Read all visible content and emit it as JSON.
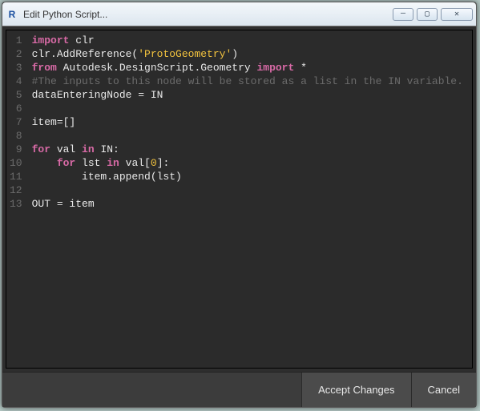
{
  "window": {
    "title": "Edit Python Script...",
    "app_icon_letter": "R"
  },
  "win_controls": {
    "minimize": "—",
    "maximize": "▢",
    "close": "✕"
  },
  "footer": {
    "accept": "Accept Changes",
    "cancel": "Cancel"
  },
  "code": {
    "line_numbers": [
      "1",
      "2",
      "3",
      "4",
      "5",
      "6",
      "7",
      "8",
      "9",
      "10",
      "11",
      "12",
      "13"
    ],
    "lines": [
      {
        "tokens": [
          {
            "t": "import",
            "c": "kw"
          },
          {
            "t": " clr",
            "c": "id"
          }
        ]
      },
      {
        "tokens": [
          {
            "t": "clr.AddReference(",
            "c": "id"
          },
          {
            "t": "'ProtoGeometry'",
            "c": "str"
          },
          {
            "t": ")",
            "c": "id"
          }
        ]
      },
      {
        "tokens": [
          {
            "t": "from",
            "c": "kw"
          },
          {
            "t": " Autodesk.DesignScript.Geometry ",
            "c": "id"
          },
          {
            "t": "import",
            "c": "kw"
          },
          {
            "t": " *",
            "c": "id"
          }
        ]
      },
      {
        "tokens": [
          {
            "t": "#The inputs to this node will be stored as a list in the IN variable.",
            "c": "cmt"
          }
        ]
      },
      {
        "tokens": [
          {
            "t": "dataEnteringNode = IN",
            "c": "id"
          }
        ]
      },
      {
        "tokens": [
          {
            "t": "",
            "c": "id"
          }
        ]
      },
      {
        "tokens": [
          {
            "t": "item=[]",
            "c": "id"
          }
        ]
      },
      {
        "tokens": [
          {
            "t": "",
            "c": "id"
          }
        ]
      },
      {
        "tokens": [
          {
            "t": "for",
            "c": "kw"
          },
          {
            "t": " val ",
            "c": "id"
          },
          {
            "t": "in",
            "c": "kw"
          },
          {
            "t": " IN:",
            "c": "id"
          }
        ]
      },
      {
        "tokens": [
          {
            "t": "    ",
            "c": "id"
          },
          {
            "t": "for",
            "c": "kw"
          },
          {
            "t": " lst ",
            "c": "id"
          },
          {
            "t": "in",
            "c": "kw"
          },
          {
            "t": " val[",
            "c": "id"
          },
          {
            "t": "0",
            "c": "num"
          },
          {
            "t": "]:",
            "c": "id"
          }
        ]
      },
      {
        "tokens": [
          {
            "t": "        item.append(lst)",
            "c": "id"
          }
        ]
      },
      {
        "tokens": [
          {
            "t": "",
            "c": "id"
          }
        ]
      },
      {
        "tokens": [
          {
            "t": "OUT = item",
            "c": "id"
          }
        ]
      }
    ]
  }
}
